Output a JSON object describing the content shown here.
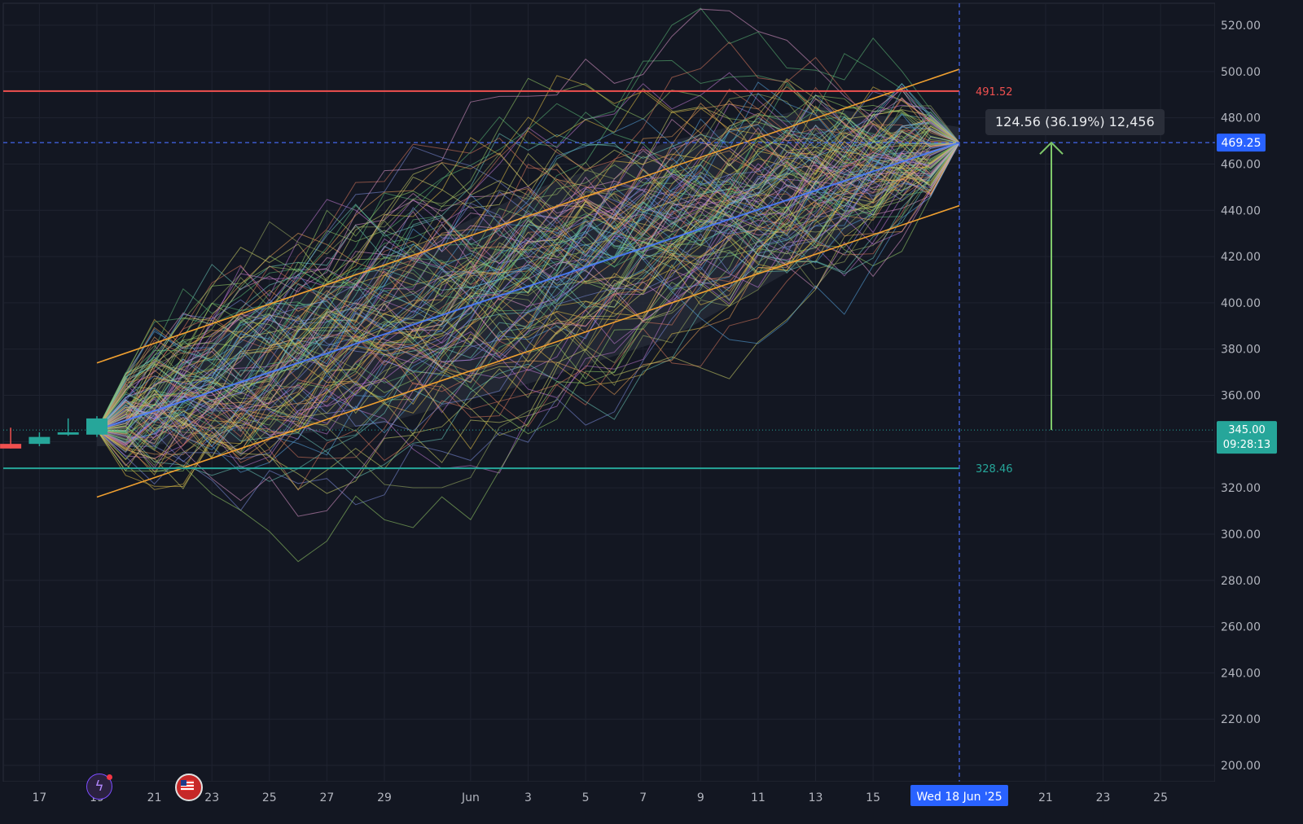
{
  "colors": {
    "background": "#131722",
    "grid": "#1f2330",
    "axis_text": "#b2b5be",
    "resistance": "#f0504f",
    "support": "#26a69a",
    "channel": "#f0a030",
    "median_path": "#4a7cff",
    "crosshair": "#3f5fd9",
    "current_price_bg": "#26a69a",
    "crosshair_price_bg": "#2962ff",
    "measure_arrow": "#7ec86a",
    "cone_fill": "#262a36"
  },
  "tooltip": {
    "text": "124.56 (36.19%) 12,456"
  },
  "icons": [
    "lightning-event-icon",
    "us-flag-event-icon"
  ],
  "chart_data": {
    "type": "line",
    "description_ticker_hidden": true,
    "x_axis": {
      "type": "date",
      "tick_labels": [
        "17",
        "19",
        "21",
        "23",
        "25",
        "27",
        "29",
        "Jun",
        "3",
        "5",
        "7",
        "9",
        "11",
        "13",
        "15",
        "21",
        "23",
        "25"
      ],
      "tick_dates": [
        "2025-05-17",
        "2025-05-19",
        "2025-05-21",
        "2025-05-23",
        "2025-05-25",
        "2025-05-27",
        "2025-05-29",
        "2025-06-01",
        "2025-06-03",
        "2025-06-05",
        "2025-06-07",
        "2025-06-09",
        "2025-06-11",
        "2025-06-13",
        "2025-06-15",
        "2025-06-21",
        "2025-06-23",
        "2025-06-25"
      ],
      "crosshair_label": "Wed 18 Jun '25",
      "crosshair_date": "2025-06-18",
      "range": [
        "2025-05-15",
        "2025-06-27"
      ]
    },
    "y_axis": {
      "ticks": [
        520,
        500,
        480,
        460,
        440,
        420,
        400,
        380,
        360,
        320,
        300,
        280,
        260,
        240,
        220,
        200
      ],
      "tick_labels": [
        "520.00",
        "500.00",
        "480.00",
        "460.00",
        "440.00",
        "420.00",
        "400.00",
        "380.00",
        "360.00",
        "320.00",
        "300.00",
        "280.00",
        "260.00",
        "240.00",
        "220.00",
        "200.00"
      ],
      "range": [
        195,
        530
      ],
      "side": "right"
    },
    "candles": [
      {
        "date": "2025-05-16",
        "open": 339,
        "high": 346,
        "low": 337,
        "close": 337
      },
      {
        "date": "2025-05-17",
        "open": 339,
        "high": 344,
        "low": 338,
        "close": 342
      },
      {
        "date": "2025-05-18",
        "open": 343,
        "high": 350,
        "low": 342.5,
        "close": 344
      },
      {
        "date": "2025-05-19",
        "open": 343,
        "high": 351,
        "low": 342,
        "close": 350
      }
    ],
    "current_price": {
      "value": 345.0,
      "label": "345.00",
      "countdown": "09:28:13"
    },
    "crosshair_price": {
      "value": 469.25,
      "label": "469.25"
    },
    "resistance_level": {
      "value": 491.52,
      "label": "491.52"
    },
    "support_level": {
      "value": 328.46,
      "label": "328.46"
    },
    "simulation": {
      "start": {
        "date": "2025-05-19",
        "value": 345
      },
      "end": {
        "date": "2025-06-18",
        "value": 469.25
      },
      "path_count": 120,
      "cone_upper": [
        [
          0,
          345
        ],
        [
          5,
          395
        ],
        [
          10,
          418
        ],
        [
          15,
          448
        ],
        [
          20,
          470
        ],
        [
          25,
          485
        ],
        [
          30,
          476
        ]
      ],
      "cone_lower": [
        [
          0,
          338
        ],
        [
          5,
          340
        ],
        [
          10,
          348
        ],
        [
          15,
          365
        ],
        [
          20,
          385
        ],
        [
          25,
          420
        ],
        [
          30,
          466
        ]
      ]
    },
    "channel": {
      "upper": [
        {
          "date": "2025-05-19",
          "value": 374
        },
        {
          "date": "2025-06-18",
          "value": 501
        }
      ],
      "lower": [
        {
          "date": "2025-05-19",
          "value": 316
        },
        {
          "date": "2025-06-18",
          "value": 442
        }
      ]
    },
    "measure": {
      "from": 345,
      "to": 469.25,
      "change": 124.56,
      "percent": "36.19%",
      "bars": "12,456"
    },
    "grid": true,
    "legend": "none"
  }
}
